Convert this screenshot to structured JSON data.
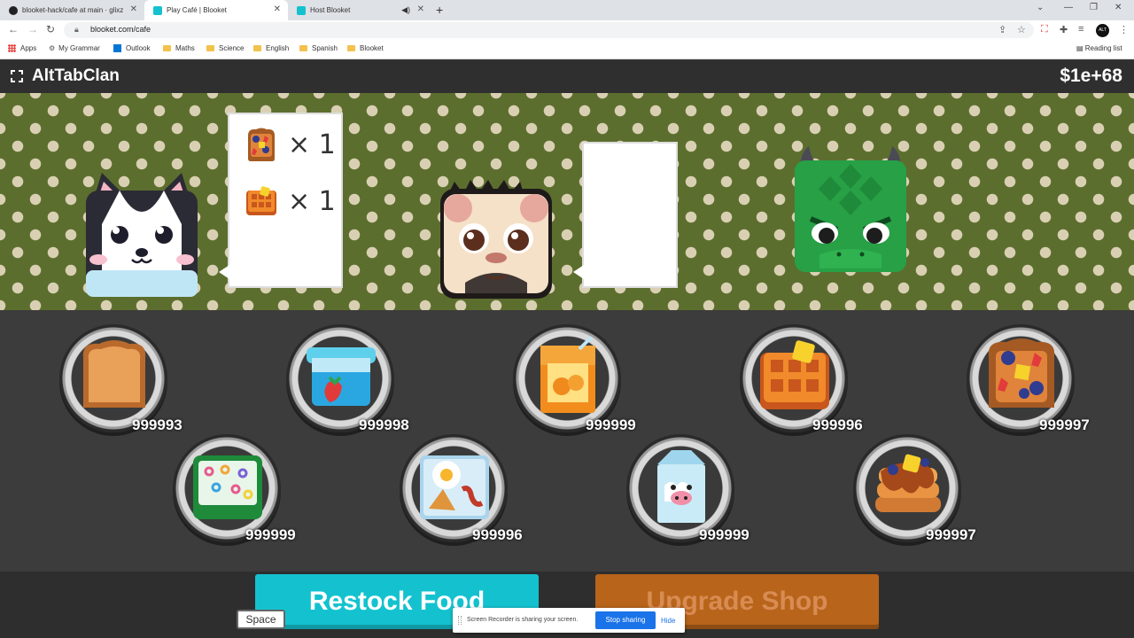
{
  "browser": {
    "tabs": [
      {
        "label": "blooket-hack/cafe at main · glixz",
        "favicon_color": "#222222"
      },
      {
        "label": "Play Café | Blooket",
        "favicon_color": "#14c2cf"
      },
      {
        "label": "Host Blooket",
        "favicon_color": "#14c2cf"
      }
    ],
    "url": "blooket.com/cafe",
    "profile_badge": "ALT TAB",
    "bookmarks": [
      "Apps",
      "My Grammar",
      "Outlook",
      "Maths",
      "Science",
      "English",
      "Spanish",
      "Blooket"
    ],
    "reading_list": "Reading list"
  },
  "game": {
    "title": "AltTabClan",
    "money": "$1e+68",
    "customers": [
      {
        "name": "husky-customer",
        "order": [
          {
            "food": "toast-with-berries",
            "qty": "× 1"
          },
          {
            "food": "waffle",
            "qty": "× 1"
          }
        ]
      },
      {
        "name": "monkey-customer",
        "order": []
      },
      {
        "name": "dragon-customer",
        "order": []
      }
    ],
    "foods": [
      {
        "name": "toast",
        "count": "999993"
      },
      {
        "name": "yogurt",
        "count": "999998"
      },
      {
        "name": "orange-juice",
        "count": "999999"
      },
      {
        "name": "waffle",
        "count": "999996"
      },
      {
        "name": "toast-with-berries",
        "count": "999997"
      },
      {
        "name": "cereal",
        "count": "999999"
      },
      {
        "name": "breakfast-plate",
        "count": "999996"
      },
      {
        "name": "milk",
        "count": "999999"
      },
      {
        "name": "pancakes",
        "count": "999997"
      }
    ],
    "restock_label": "Restock Food",
    "upgrade_label": "Upgrade Shop",
    "space_label": "Space"
  },
  "screen_share": {
    "message": "Screen Recorder is sharing your screen.",
    "stop_label": "Stop sharing",
    "hide_label": "Hide"
  },
  "colors": {
    "accent": "#14c2cf",
    "upgrade": "#b8641a",
    "wallpaper": "#5c6e2e"
  }
}
